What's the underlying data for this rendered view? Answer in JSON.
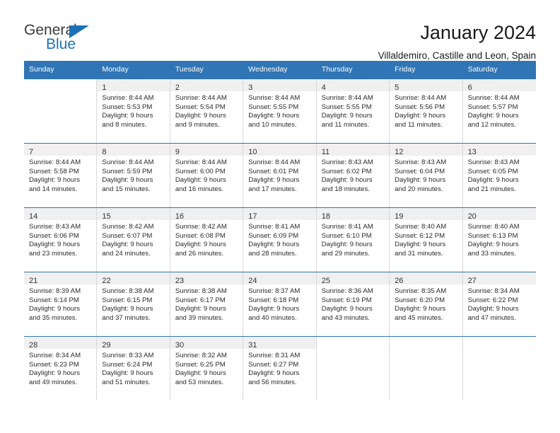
{
  "brand": {
    "name_part1": "General",
    "name_part2": "Blue",
    "triangle_color": "#1b72b8",
    "text_color": "#3b3b3b"
  },
  "header": {
    "title": "January 2024",
    "subtitle": "Villaldemiro, Castille and Leon, Spain"
  },
  "theme": {
    "header_blue": "#3075b5",
    "daynum_band": "#f0f0f0",
    "cell_border": "#d9d9d9"
  },
  "weekdays": [
    "Sunday",
    "Monday",
    "Tuesday",
    "Wednesday",
    "Thursday",
    "Friday",
    "Saturday"
  ],
  "weeks": [
    [
      {
        "day": "",
        "sunrise": "",
        "sunset": "",
        "daylight1": "",
        "daylight2": ""
      },
      {
        "day": "1",
        "sunrise": "Sunrise: 8:44 AM",
        "sunset": "Sunset: 5:53 PM",
        "daylight1": "Daylight: 9 hours",
        "daylight2": "and 8 minutes."
      },
      {
        "day": "2",
        "sunrise": "Sunrise: 8:44 AM",
        "sunset": "Sunset: 5:54 PM",
        "daylight1": "Daylight: 9 hours",
        "daylight2": "and 9 minutes."
      },
      {
        "day": "3",
        "sunrise": "Sunrise: 8:44 AM",
        "sunset": "Sunset: 5:55 PM",
        "daylight1": "Daylight: 9 hours",
        "daylight2": "and 10 minutes."
      },
      {
        "day": "4",
        "sunrise": "Sunrise: 8:44 AM",
        "sunset": "Sunset: 5:55 PM",
        "daylight1": "Daylight: 9 hours",
        "daylight2": "and 11 minutes."
      },
      {
        "day": "5",
        "sunrise": "Sunrise: 8:44 AM",
        "sunset": "Sunset: 5:56 PM",
        "daylight1": "Daylight: 9 hours",
        "daylight2": "and 11 minutes."
      },
      {
        "day": "6",
        "sunrise": "Sunrise: 8:44 AM",
        "sunset": "Sunset: 5:57 PM",
        "daylight1": "Daylight: 9 hours",
        "daylight2": "and 12 minutes."
      }
    ],
    [
      {
        "day": "7",
        "sunrise": "Sunrise: 8:44 AM",
        "sunset": "Sunset: 5:58 PM",
        "daylight1": "Daylight: 9 hours",
        "daylight2": "and 14 minutes."
      },
      {
        "day": "8",
        "sunrise": "Sunrise: 8:44 AM",
        "sunset": "Sunset: 5:59 PM",
        "daylight1": "Daylight: 9 hours",
        "daylight2": "and 15 minutes."
      },
      {
        "day": "9",
        "sunrise": "Sunrise: 8:44 AM",
        "sunset": "Sunset: 6:00 PM",
        "daylight1": "Daylight: 9 hours",
        "daylight2": "and 16 minutes."
      },
      {
        "day": "10",
        "sunrise": "Sunrise: 8:44 AM",
        "sunset": "Sunset: 6:01 PM",
        "daylight1": "Daylight: 9 hours",
        "daylight2": "and 17 minutes."
      },
      {
        "day": "11",
        "sunrise": "Sunrise: 8:43 AM",
        "sunset": "Sunset: 6:02 PM",
        "daylight1": "Daylight: 9 hours",
        "daylight2": "and 18 minutes."
      },
      {
        "day": "12",
        "sunrise": "Sunrise: 8:43 AM",
        "sunset": "Sunset: 6:04 PM",
        "daylight1": "Daylight: 9 hours",
        "daylight2": "and 20 minutes."
      },
      {
        "day": "13",
        "sunrise": "Sunrise: 8:43 AM",
        "sunset": "Sunset: 6:05 PM",
        "daylight1": "Daylight: 9 hours",
        "daylight2": "and 21 minutes."
      }
    ],
    [
      {
        "day": "14",
        "sunrise": "Sunrise: 8:43 AM",
        "sunset": "Sunset: 6:06 PM",
        "daylight1": "Daylight: 9 hours",
        "daylight2": "and 23 minutes."
      },
      {
        "day": "15",
        "sunrise": "Sunrise: 8:42 AM",
        "sunset": "Sunset: 6:07 PM",
        "daylight1": "Daylight: 9 hours",
        "daylight2": "and 24 minutes."
      },
      {
        "day": "16",
        "sunrise": "Sunrise: 8:42 AM",
        "sunset": "Sunset: 6:08 PM",
        "daylight1": "Daylight: 9 hours",
        "daylight2": "and 26 minutes."
      },
      {
        "day": "17",
        "sunrise": "Sunrise: 8:41 AM",
        "sunset": "Sunset: 6:09 PM",
        "daylight1": "Daylight: 9 hours",
        "daylight2": "and 28 minutes."
      },
      {
        "day": "18",
        "sunrise": "Sunrise: 8:41 AM",
        "sunset": "Sunset: 6:10 PM",
        "daylight1": "Daylight: 9 hours",
        "daylight2": "and 29 minutes."
      },
      {
        "day": "19",
        "sunrise": "Sunrise: 8:40 AM",
        "sunset": "Sunset: 6:12 PM",
        "daylight1": "Daylight: 9 hours",
        "daylight2": "and 31 minutes."
      },
      {
        "day": "20",
        "sunrise": "Sunrise: 8:40 AM",
        "sunset": "Sunset: 6:13 PM",
        "daylight1": "Daylight: 9 hours",
        "daylight2": "and 33 minutes."
      }
    ],
    [
      {
        "day": "21",
        "sunrise": "Sunrise: 8:39 AM",
        "sunset": "Sunset: 6:14 PM",
        "daylight1": "Daylight: 9 hours",
        "daylight2": "and 35 minutes."
      },
      {
        "day": "22",
        "sunrise": "Sunrise: 8:38 AM",
        "sunset": "Sunset: 6:15 PM",
        "daylight1": "Daylight: 9 hours",
        "daylight2": "and 37 minutes."
      },
      {
        "day": "23",
        "sunrise": "Sunrise: 8:38 AM",
        "sunset": "Sunset: 6:17 PM",
        "daylight1": "Daylight: 9 hours",
        "daylight2": "and 39 minutes."
      },
      {
        "day": "24",
        "sunrise": "Sunrise: 8:37 AM",
        "sunset": "Sunset: 6:18 PM",
        "daylight1": "Daylight: 9 hours",
        "daylight2": "and 40 minutes."
      },
      {
        "day": "25",
        "sunrise": "Sunrise: 8:36 AM",
        "sunset": "Sunset: 6:19 PM",
        "daylight1": "Daylight: 9 hours",
        "daylight2": "and 43 minutes."
      },
      {
        "day": "26",
        "sunrise": "Sunrise: 8:35 AM",
        "sunset": "Sunset: 6:20 PM",
        "daylight1": "Daylight: 9 hours",
        "daylight2": "and 45 minutes."
      },
      {
        "day": "27",
        "sunrise": "Sunrise: 8:34 AM",
        "sunset": "Sunset: 6:22 PM",
        "daylight1": "Daylight: 9 hours",
        "daylight2": "and 47 minutes."
      }
    ],
    [
      {
        "day": "28",
        "sunrise": "Sunrise: 8:34 AM",
        "sunset": "Sunset: 6:23 PM",
        "daylight1": "Daylight: 9 hours",
        "daylight2": "and 49 minutes."
      },
      {
        "day": "29",
        "sunrise": "Sunrise: 8:33 AM",
        "sunset": "Sunset: 6:24 PM",
        "daylight1": "Daylight: 9 hours",
        "daylight2": "and 51 minutes."
      },
      {
        "day": "30",
        "sunrise": "Sunrise: 8:32 AM",
        "sunset": "Sunset: 6:25 PM",
        "daylight1": "Daylight: 9 hours",
        "daylight2": "and 53 minutes."
      },
      {
        "day": "31",
        "sunrise": "Sunrise: 8:31 AM",
        "sunset": "Sunset: 6:27 PM",
        "daylight1": "Daylight: 9 hours",
        "daylight2": "and 56 minutes."
      },
      {
        "day": "",
        "sunrise": "",
        "sunset": "",
        "daylight1": "",
        "daylight2": ""
      },
      {
        "day": "",
        "sunrise": "",
        "sunset": "",
        "daylight1": "",
        "daylight2": ""
      },
      {
        "day": "",
        "sunrise": "",
        "sunset": "",
        "daylight1": "",
        "daylight2": ""
      }
    ]
  ]
}
